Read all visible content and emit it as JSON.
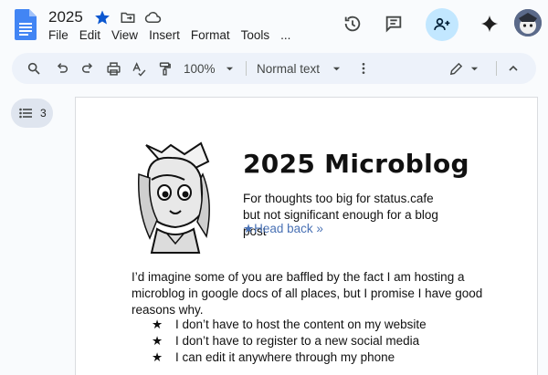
{
  "doc": {
    "title": "2025"
  },
  "menu": [
    "File",
    "Edit",
    "View",
    "Insert",
    "Format",
    "Tools",
    "..."
  ],
  "toolbar": {
    "zoom": "100%",
    "style": "Normal text"
  },
  "outline": {
    "count": "3"
  },
  "content": {
    "title": "2025 Microblog",
    "subtitle": "For thoughts too big for status.cafe but not significant enough for a blog post",
    "head_back": "★Head back »",
    "paragraph": "I’d imagine some of you are baffled by the fact I am hosting a microblog in google docs of all places, but I promise I have good reasons why.",
    "bullets": [
      "I don’t have to host the content on my website",
      "I don’t have to register to a new social media",
      "I can edit it anywhere through my phone"
    ]
  },
  "colors": {
    "accent": "#0b57d0",
    "share_bg": "#c2e7ff",
    "toolbar_bg": "#edf2fa",
    "link": "#4a72b5"
  }
}
